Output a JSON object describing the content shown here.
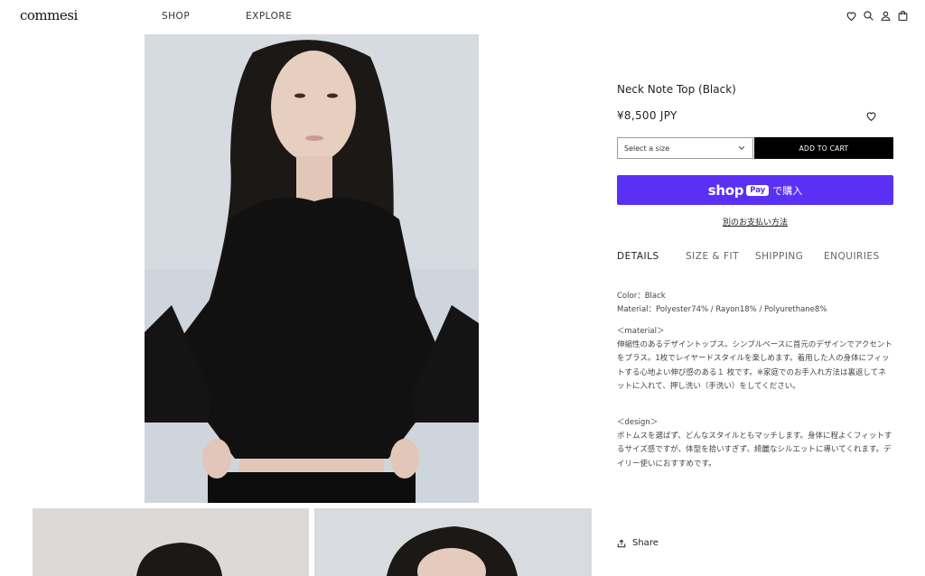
{
  "header": {
    "logo": "commesi",
    "nav": {
      "shop": "SHOP",
      "explore": "EXPLORE"
    },
    "icons": [
      "heart-icon",
      "search-icon",
      "account-icon",
      "cart-icon"
    ]
  },
  "product": {
    "title": "Neck Note Top (Black)",
    "price": "¥8,500 JPY",
    "size_select": {
      "placeholder": "Select a size"
    },
    "add_to_cart": "ADD TO CART",
    "shop_pay": {
      "shop": "shop",
      "pay": "Pay",
      "buy": "で購入"
    },
    "alt_payment": "別のお支払い方法",
    "tabs": [
      {
        "label": "DETAILS",
        "active": true
      },
      {
        "label": "SIZE & FIT",
        "active": false
      },
      {
        "label": "SHIPPING",
        "active": false
      },
      {
        "label": "ENQUIRIES",
        "active": false
      }
    ],
    "details": {
      "color": "Color：Black",
      "material": "Material：Polyester74% / Rayon18% / Polyurethane8%",
      "material_heading": "＜material＞",
      "material_text": "伸縮性のあるデザイントップス。シンプルベースに首元のデザインでアクセントをプラス。1枚でレイヤードスタイルを楽しめます。着用した人の身体にフィットする心地よい伸び感のある１ 枚です。※家庭でのお手入れ方法は裏返してネットに入れて、押し洗い（手洗い）をしてください。",
      "design_heading": "＜design＞",
      "design_text": "ボトムスを選ばず、どんなスタイルともマッチします。身体に程よくフィットするサイズ感ですが、体型を拾いすぎず、綺麗なシルエットに導いてくれます。デイリー使いにおすすめです。"
    },
    "share": "Share"
  },
  "colors": {
    "accent_shop_pay": "#5a31f4",
    "cart_button": "#000000"
  }
}
